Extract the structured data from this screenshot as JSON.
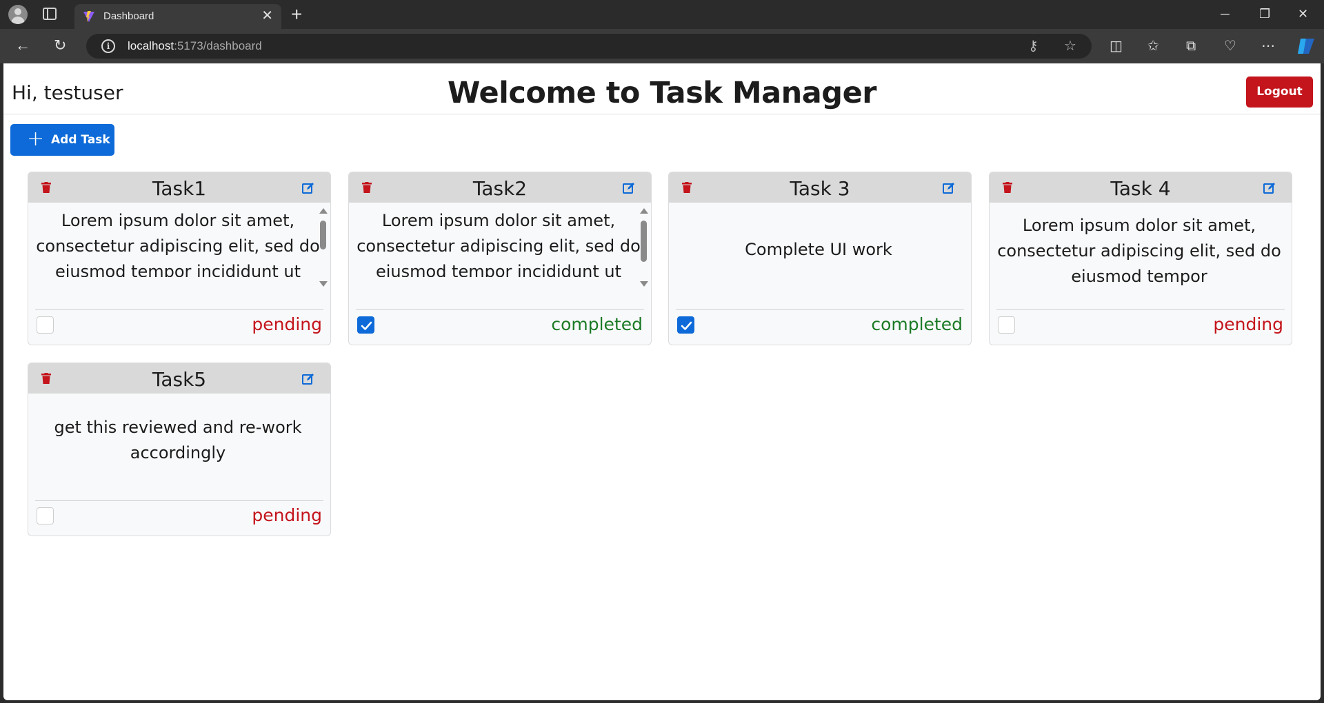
{
  "browser": {
    "tab_title": "Dashboard",
    "url_host": "localhost",
    "url_path": ":5173/dashboard",
    "tab_close_glyph": "✕",
    "new_tab_glyph": "+"
  },
  "header": {
    "greeting": "Hi, testuser",
    "title": "Welcome to Task Manager",
    "logout_label": "Logout"
  },
  "actions": {
    "add_task_label": "Add Task",
    "add_task_icon": "plus-icon"
  },
  "colors": {
    "primary": "#0d6ad8",
    "danger": "#c4141c",
    "success": "#1b7a25",
    "card_header": "#d9d9d9"
  },
  "tasks": [
    {
      "title": "Task1",
      "description": "Lorem ipsum dolor sit amet, consectetur adipiscing elit, sed do eiusmod tempor incididunt ut labore et dolore magna aliqua.",
      "status": "pending",
      "checked": false
    },
    {
      "title": "Task2",
      "description": "Lorem ipsum dolor sit amet, consectetur adipiscing elit, sed do eiusmod tempor incididunt ut labore et dolore magna aliqua.",
      "status": "completed",
      "checked": true
    },
    {
      "title": "Task 3",
      "description": "Complete UI work",
      "status": "completed",
      "checked": true
    },
    {
      "title": "Task 4",
      "description": "Lorem ipsum dolor sit amet, consectetur adipiscing elit, sed do eiusmod tempor",
      "status": "pending",
      "checked": false
    },
    {
      "title": "Task5",
      "description": "get this reviewed and re-work accordingly",
      "status": "pending",
      "checked": false
    }
  ]
}
